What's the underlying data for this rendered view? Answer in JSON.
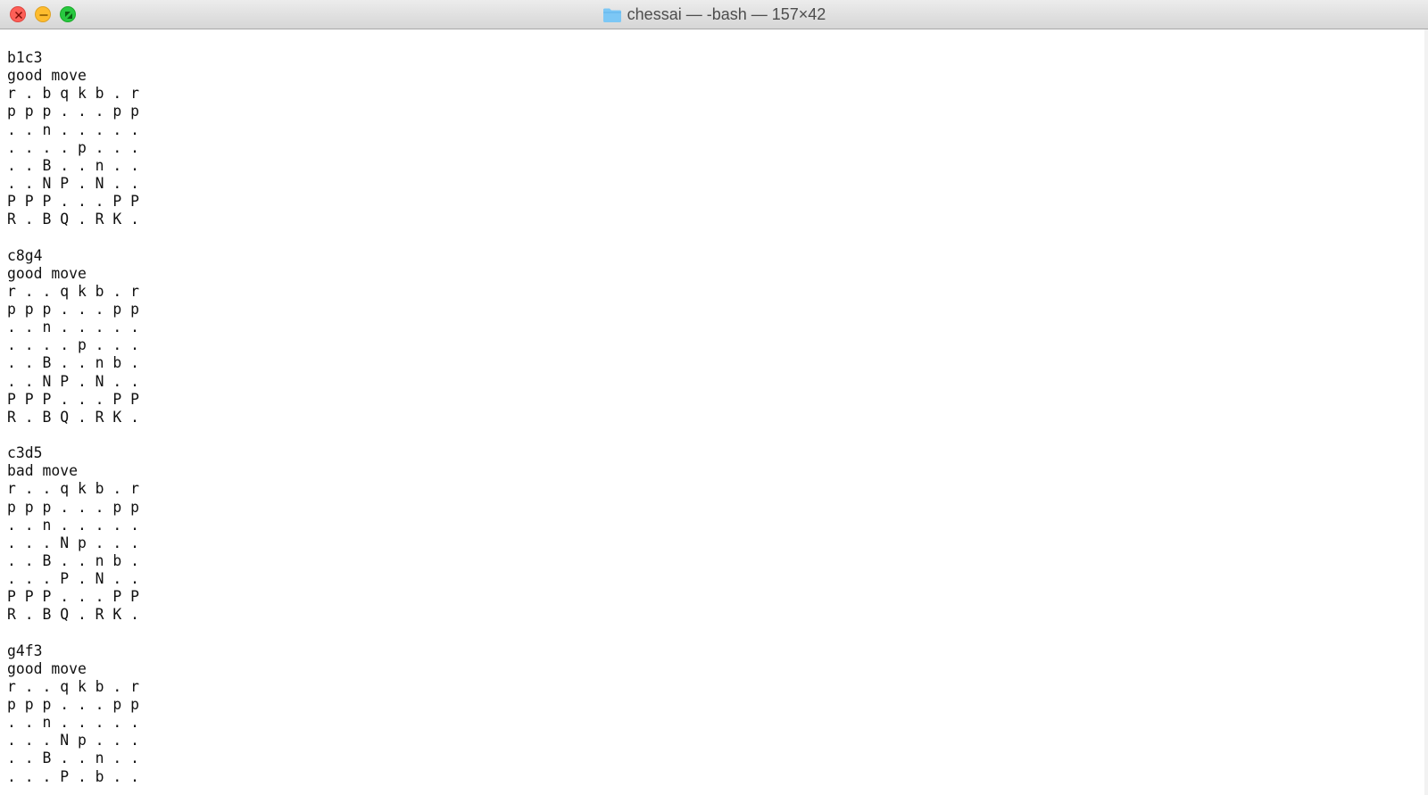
{
  "window": {
    "title": "chessai — -bash — 157×42",
    "folder_icon": "folder-icon",
    "buttons": {
      "close": "close-icon",
      "minimize": "minimize-icon",
      "zoom": "zoom-icon"
    },
    "colors": {
      "close": "#fd5f57",
      "minimize": "#febc2e",
      "zoom": "#28c840",
      "folder": "#7cc7f5"
    }
  },
  "terminal": {
    "lines": [
      "b1c3",
      "good move",
      "r . b q k b . r",
      "p p p . . . p p",
      ". . n . . . . .",
      ". . . . p . . .",
      ". . B . . n . .",
      ". . N P . N . .",
      "P P P . . . P P",
      "R . B Q . R K .",
      "",
      "c8g4",
      "good move",
      "r . . q k b . r",
      "p p p . . . p p",
      ". . n . . . . .",
      ". . . . p . . .",
      ". . B . . n b .",
      ". . N P . N . .",
      "P P P . . . P P",
      "R . B Q . R K .",
      "",
      "c3d5",
      "bad move",
      "r . . q k b . r",
      "p p p . . . p p",
      ". . n . . . . .",
      ". . . N p . . .",
      ". . B . . n b .",
      ". . . P . N . .",
      "P P P . . . P P",
      "R . B Q . R K .",
      "",
      "g4f3",
      "good move",
      "r . . q k b . r",
      "p p p . . . p p",
      ". . n . . . . .",
      ". . . N p . . .",
      ". . B . . n . .",
      ". . . P . b . ."
    ]
  }
}
